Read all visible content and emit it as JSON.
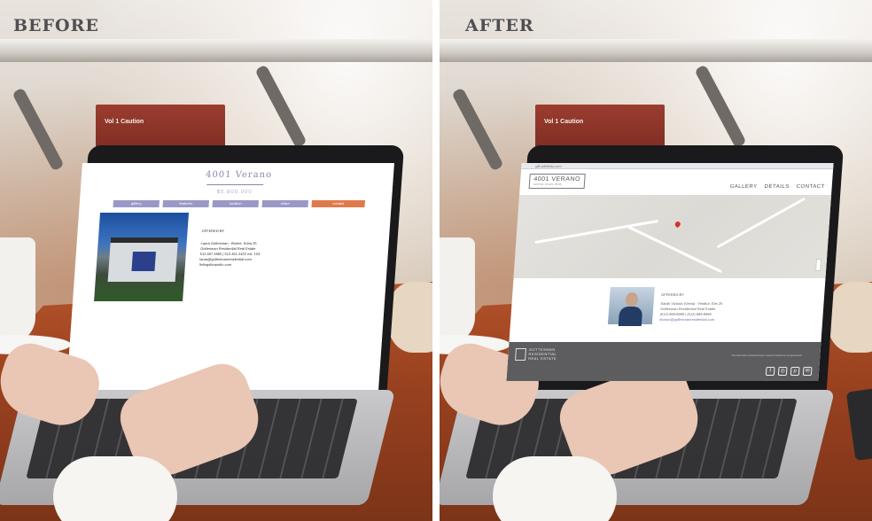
{
  "labels": {
    "before": "BEFORE",
    "after": "AFTER"
  },
  "background": {
    "book_text": "Vol 1 Caution"
  },
  "before_site": {
    "title": "4001 Verano",
    "price": "$5,800,000",
    "nav": [
      "gallery",
      "features",
      "location",
      "share",
      "contact"
    ],
    "offered_by": "OFFERED BY",
    "agent_lines": [
      "Laura Gottesman - Broker, Ecba 25",
      "Gottesman Residential Real Estate",
      "512.657.4960 | 512.451.2422 ext. 103",
      "laura@gottesmanresidential.com",
      "listingsforaustin.com"
    ]
  },
  "after_site": {
    "url": "gill.adefinity.com",
    "logo": "4001 VERANO",
    "logo_sub": "AUSTIN, TEXAS 78735",
    "nav": [
      "GALLERY",
      "DETAILS",
      "CONTACT"
    ],
    "offered_by": "OFFERED BY",
    "agent_lines": [
      "Sarah Victoria (Vieira) - Realtor, Ebs 25",
      "Gottesman Residential Real Estate",
      "(512) 999-9999 | (512) 999-9999",
      "sharon@gottesmanresidential.com"
    ],
    "footer_name_lines": [
      "GOTTESMAN",
      "RESIDENTIAL",
      "REAL ESTATE"
    ],
    "footer_legal": "The information contained herein is deemed reliable but not guaranteed.",
    "social_icons": [
      "facebook-icon",
      "instagram-icon",
      "pinterest-icon",
      "mail-icon"
    ]
  }
}
